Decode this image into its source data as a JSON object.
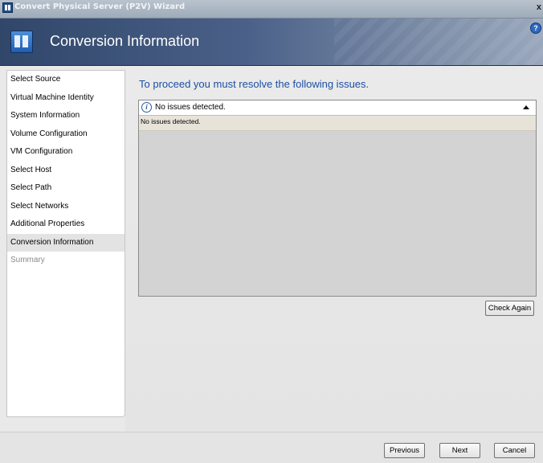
{
  "window": {
    "title": "Convert Physical Server (P2V) Wizard",
    "close_glyph": "x"
  },
  "banner": {
    "heading": "Conversion Information",
    "help_glyph": "?"
  },
  "sidebar": {
    "items": [
      {
        "label": "Select Source",
        "state": "normal"
      },
      {
        "label": "Virtual Machine Identity",
        "state": "normal"
      },
      {
        "label": "System Information",
        "state": "normal"
      },
      {
        "label": "Volume Configuration",
        "state": "normal"
      },
      {
        "label": "VM Configuration",
        "state": "normal"
      },
      {
        "label": "Select Host",
        "state": "normal"
      },
      {
        "label": "Select Path",
        "state": "normal"
      },
      {
        "label": "Select Networks",
        "state": "normal"
      },
      {
        "label": "Additional Properties",
        "state": "normal"
      },
      {
        "label": "Conversion Information",
        "state": "active"
      },
      {
        "label": "Summary",
        "state": "disabled"
      }
    ]
  },
  "main": {
    "heading": "To proceed you must resolve the following issues.",
    "issue": {
      "icon": "info-icon",
      "title": "No issues detected.",
      "detail": "No issues detected."
    },
    "check_again_label": "Check Again"
  },
  "footer": {
    "previous_label": "Previous",
    "next_label": "Next",
    "cancel_label": "Cancel"
  },
  "colors": {
    "heading_blue": "#1c4fa5",
    "banner_dark": "#30476a"
  }
}
